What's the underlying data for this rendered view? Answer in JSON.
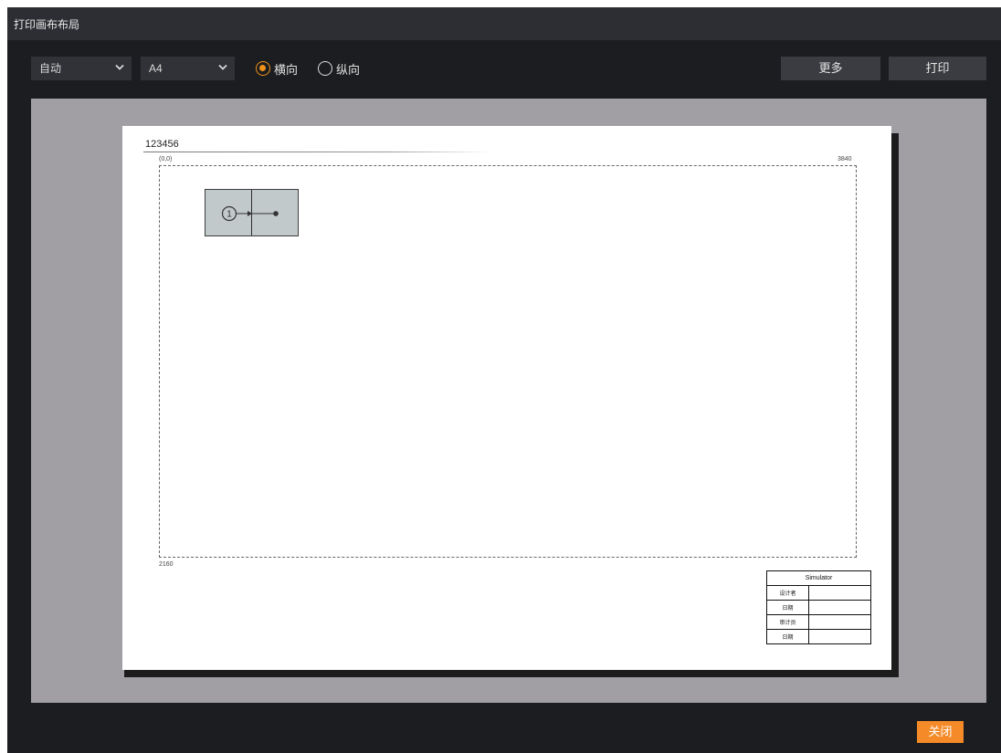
{
  "window": {
    "title": "打印画布布局"
  },
  "toolbar": {
    "scale_select": {
      "value": "自动",
      "icon": "chevron-down-icon"
    },
    "paper_select": {
      "value": "A4",
      "icon": "chevron-down-icon"
    },
    "orientation": {
      "options": [
        {
          "label": "横向",
          "checked": true
        },
        {
          "label": "纵向",
          "checked": false
        }
      ]
    },
    "more_label": "更多",
    "print_label": "打印"
  },
  "page": {
    "doc_title": "123456",
    "origin_label": "(0,0)",
    "width_label": "3840",
    "height_label": "2160",
    "block": {
      "number": "1"
    },
    "title_block": {
      "header": "Simulator",
      "rows": [
        {
          "label": "设计者",
          "value": ""
        },
        {
          "label": "日期",
          "value": ""
        },
        {
          "label": "审计员",
          "value": ""
        },
        {
          "label": "日期",
          "value": ""
        }
      ]
    }
  },
  "footer": {
    "close_label": "关闭"
  },
  "colors": {
    "accent": "#f0921a",
    "close_button": "#f58a28",
    "preview_bg": "#a19fa4",
    "window_bg": "#1c1d20"
  }
}
